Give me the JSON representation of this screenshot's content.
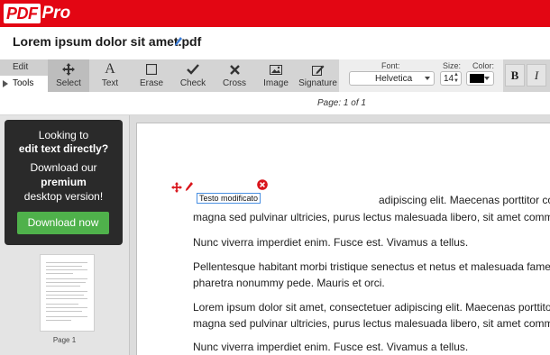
{
  "brand": {
    "logo_box": "PDF",
    "logo_text": "Pro",
    "color": "#e30613"
  },
  "file": {
    "name": "Lorem ipsum dolor sit amet.pdf",
    "edit_icon": "pencil-icon"
  },
  "modes": {
    "edit": "Edit",
    "tools": "Tools"
  },
  "tools": [
    {
      "label": "Select",
      "icon": "move-icon",
      "active": true
    },
    {
      "label": "Text",
      "icon": "text-a-icon"
    },
    {
      "label": "Erase",
      "icon": "square-icon"
    },
    {
      "label": "Check",
      "icon": "check-icon"
    },
    {
      "label": "Cross",
      "icon": "cross-icon"
    },
    {
      "label": "Image",
      "icon": "image-icon"
    },
    {
      "label": "Signature",
      "icon": "signature-pen-icon"
    }
  ],
  "format": {
    "font_label": "Font:",
    "font_value": "Helvetica",
    "size_label": "Size:",
    "size_value": "14",
    "color_label": "Color:",
    "color_value": "#000000",
    "bold": "B",
    "italic": "I"
  },
  "pager": {
    "text": "Page: 1 of 1"
  },
  "promo": {
    "line1": "Looking to",
    "line2": "edit text directly?",
    "line3": "Download our",
    "line4": "premium",
    "line5": "desktop version!",
    "button": "Download now",
    "button_color": "#4fb14b"
  },
  "thumbnail": {
    "label": "Page 1"
  },
  "document": {
    "field_value": "Testo modificato",
    "lines": [
      "adipiscing elit. Maecenas porttitor congue massa. Fusce posuere,",
      "magna sed pulvinar ultricies, purus lectus malesuada libero, sit amet commodo magna",
      "Nunc viverra imperdiet enim. Fusce est. Vivamus a tellus.",
      "Pellentesque habitant morbi tristique senectus et netus et malesuada fames ac turpis egestas.",
      "pharetra nonummy pede. Mauris et orci.",
      "Lorem ipsum dolor sit amet, consectetuer adipiscing elit. Maecenas porttitor congue massa.",
      "magna sed pulvinar ultricies, purus lectus malesuada libero, sit amet commodo magna",
      "Nunc viverra imperdiet enim. Fusce est. Vivamus a tellus."
    ]
  }
}
